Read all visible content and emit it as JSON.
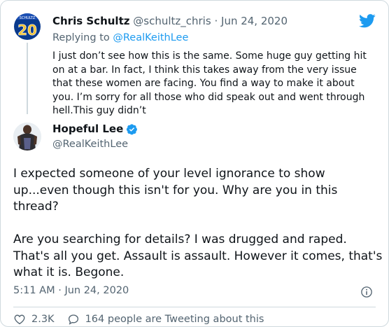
{
  "parent_tweet": {
    "name": "Chris Schultz",
    "handle": "@schultz_chris",
    "separator": "·",
    "date": "Jun 24, 2020",
    "replying_prefix": "Replying to",
    "replying_to": "@RealKeithLee",
    "text": "I just don’t see how this is the same.  Some huge guy getting hit on at a bar.  In fact, I think this takes away from the very issue that these women are facing.  You find a way to make it about you. I’m sorry for all those who did speak out and went through hell.This guy didn’t",
    "avatar_jersey_name": "SCHULTZ",
    "avatar_jersey_number": "20"
  },
  "main_tweet": {
    "name": "Hopeful Lee",
    "handle": "@RealKeithLee",
    "text": "I expected someone of your level ignorance to show up...even though this isn't for you.  Why are you in this thread?\n\nAre you searching for details? I was drugged and raped. That's all you get. Assault is assault. However it comes, that's what it is. Begone.",
    "time": "5:11 AM",
    "separator": "·",
    "date": "Jun 24, 2020"
  },
  "actions": {
    "like_count": "2.3K",
    "comments_label": "164 people are Tweeting about this"
  },
  "colors": {
    "twitter_blue": "#1d9bf0",
    "like_red": "#e0245e",
    "muted_text": "#536471"
  },
  "icons": [
    "twitter-logo-icon",
    "verified-badge-icon",
    "info-icon",
    "heart-icon",
    "comment-icon"
  ]
}
